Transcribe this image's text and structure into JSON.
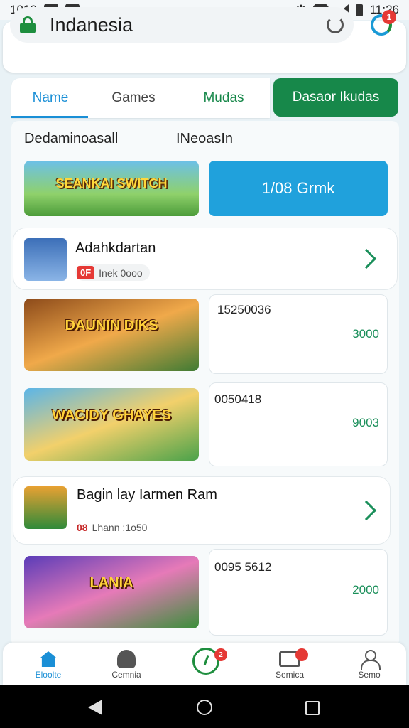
{
  "status_bar": {
    "left_text": "1010",
    "time": "11:26"
  },
  "url_bar": {
    "text": "Indanesia",
    "profile_badge": "1"
  },
  "tabs": [
    {
      "label": "Name",
      "active": true
    },
    {
      "label": "Games",
      "active": false
    },
    {
      "label": "Mudas",
      "active": false
    }
  ],
  "tab_cta": "Dasaor Ikudas",
  "subheader": {
    "left": "Dedaminoasall",
    "right": "INeoasIn"
  },
  "banner": {
    "text": "SEANKAI SWITCH"
  },
  "blue_button": "1/08 Grmk",
  "list_items": [
    {
      "title": "Adahkdartan",
      "badge": "0F",
      "meta": "Inek 0ooo"
    },
    {
      "title": "Bagin lay Iarmen Ram",
      "badge": "08",
      "meta": "Lhann :1o50"
    }
  ],
  "game_rows": [
    {
      "thumb_text": "DAUNIN DIKS",
      "id": "15250036",
      "value": "3000"
    },
    {
      "thumb_text": "WACIDY GHAYES",
      "id": "0050418",
      "value": "9003"
    },
    {
      "thumb_text": "LANIA",
      "id": "0095 5612",
      "value": "2000"
    }
  ],
  "bottom_nav": [
    {
      "label": "Eloolte",
      "icon": "home-icon"
    },
    {
      "label": "Cemnia",
      "icon": "camera-icon"
    },
    {
      "label": "",
      "icon": "clock-icon",
      "badge": "2"
    },
    {
      "label": "Semica",
      "icon": "cart-icon",
      "badge": ""
    },
    {
      "label": "Semo",
      "icon": "user-icon"
    }
  ],
  "colors": {
    "accent_blue": "#1a8fd6",
    "brand_green": "#17884a",
    "badge_red": "#e53935",
    "button_blue": "#20a1dc"
  }
}
